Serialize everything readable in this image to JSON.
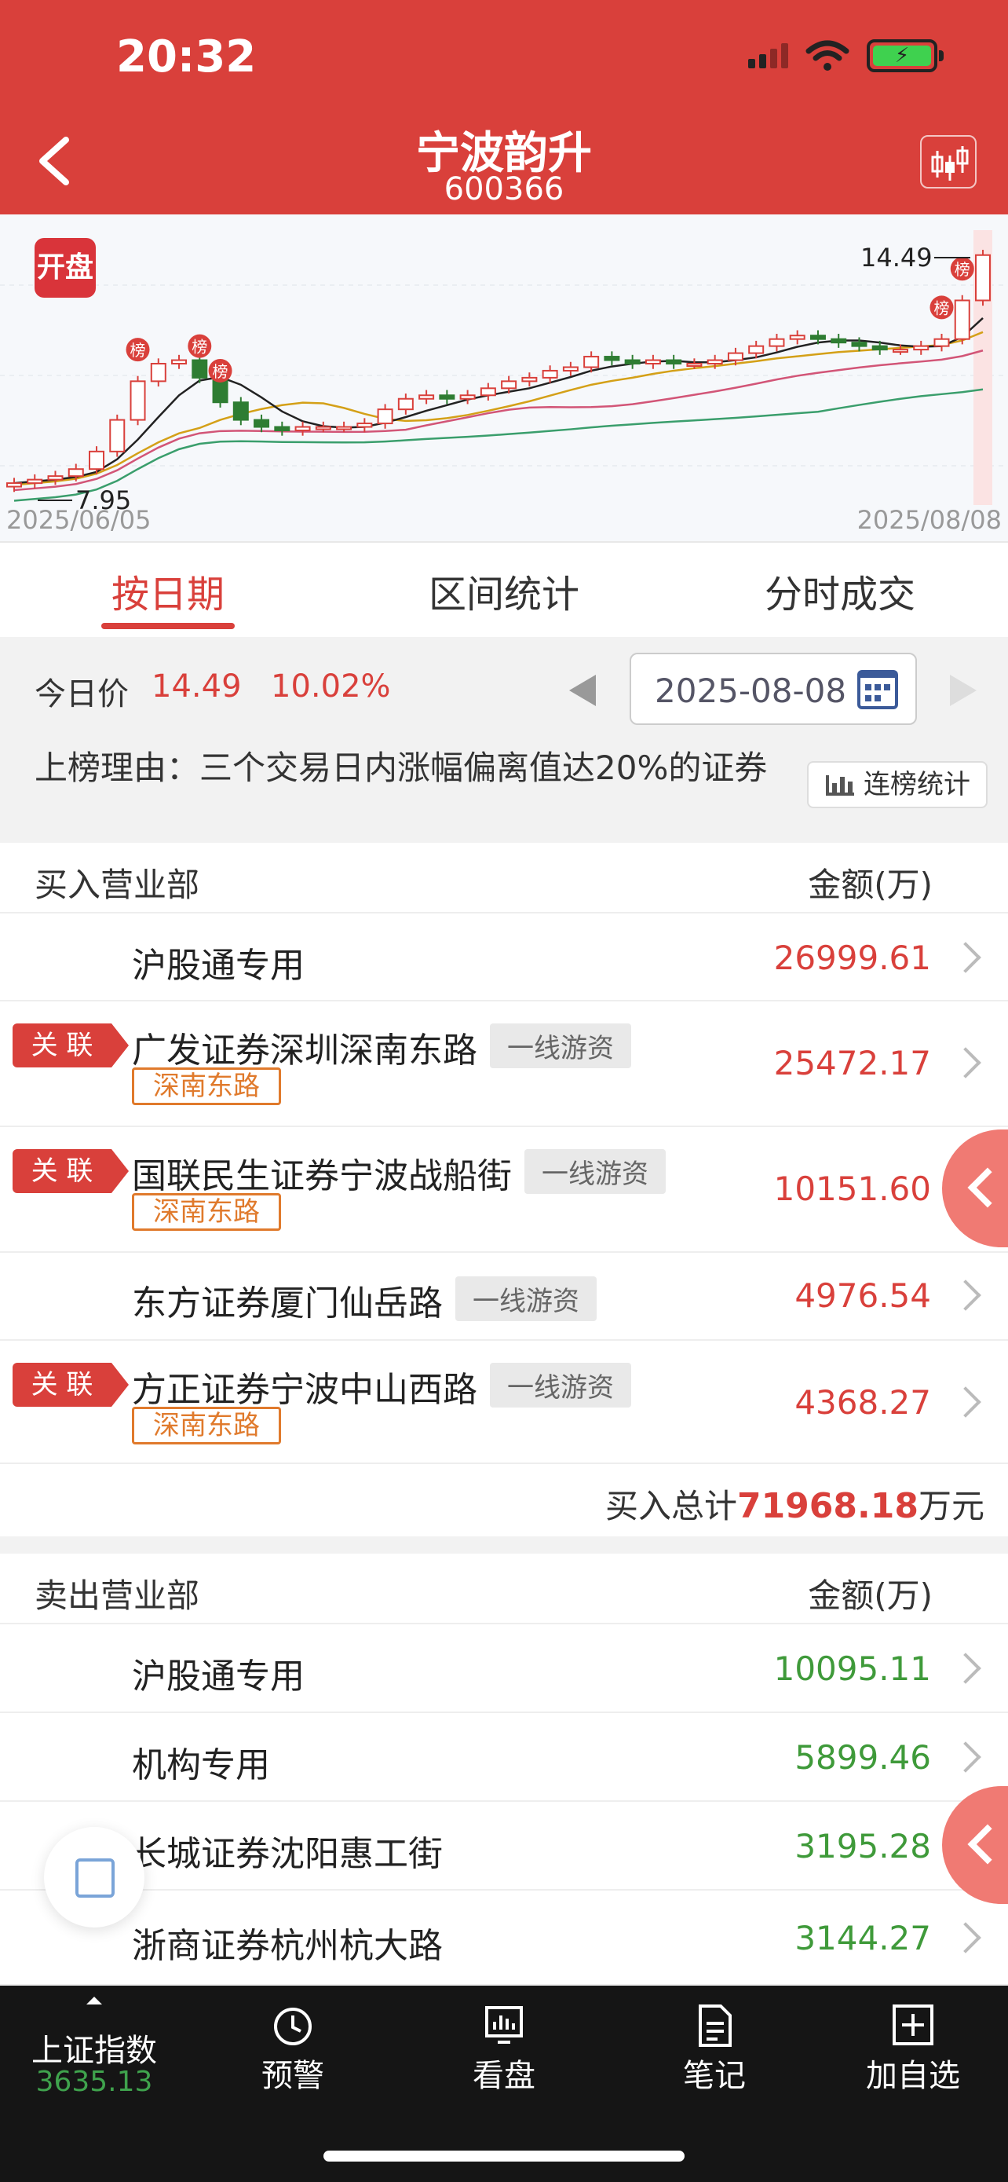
{
  "status_bar": {
    "time": "20:32"
  },
  "header": {
    "title": "宁波韵升",
    "code": "600366"
  },
  "chart_data": {
    "type": "candlestick",
    "badge": "开盘",
    "start_date": "2025/06/05",
    "end_date": "2025/08/08",
    "low_label": "7.95",
    "high_label": "14.49",
    "marker_label": "榜",
    "colors": {
      "up": "#d9403b",
      "down": "#2e7d32",
      "ma5": "#222222",
      "ma10": "#d4a017",
      "ma20": "#d25577",
      "ma60": "#3a9e6c"
    }
  },
  "tabs": [
    {
      "label": "按日期",
      "active": true
    },
    {
      "label": "区间统计",
      "active": false
    },
    {
      "label": "分时成交",
      "active": false
    }
  ],
  "today": {
    "label": "今日价",
    "price": "14.49",
    "change_pct": "10.02%",
    "date": "2025-08-08"
  },
  "reason": {
    "text": "上榜理由：三个交易日内涨幅偏离值达20%的证券",
    "stat_button": "连榜统计"
  },
  "buy": {
    "header_left": "买入营业部",
    "header_right": "金额(万)",
    "rows": [
      {
        "name": "沪股通专用",
        "amount": "26999.61"
      },
      {
        "name": "广发证券深圳深南东路",
        "tag": "一线游资",
        "sub": "深南东路",
        "related": "关 联",
        "amount": "25472.17"
      },
      {
        "name": "国联民生证券宁波战船街",
        "tag": "一线游资",
        "sub": "深南东路",
        "related": "关 联",
        "amount": "10151.60"
      },
      {
        "name": "东方证券厦门仙岳路",
        "tag": "一线游资",
        "amount": "4976.54"
      },
      {
        "name": "方正证券宁波中山西路",
        "tag": "一线游资",
        "sub": "深南东路",
        "related": "关 联",
        "amount": "4368.27"
      }
    ],
    "total_label": "买入总计",
    "total_value": "71968.18",
    "total_unit": "万元"
  },
  "sell": {
    "header_left": "卖出营业部",
    "header_right": "金额(万)",
    "rows": [
      {
        "name": "沪股通专用",
        "amount": "10095.11"
      },
      {
        "name": "机构专用",
        "amount": "5899.46"
      },
      {
        "name": "长城证券沈阳惠工街",
        "amount": "3195.28"
      },
      {
        "name": "浙商证券杭州杭大路",
        "amount": "3144.27"
      }
    ]
  },
  "tabbar": {
    "items": [
      {
        "label": "上证指数",
        "value": "3635.13",
        "icon": "triangle-up-icon"
      },
      {
        "label": "预警",
        "icon": "alarm-clock-icon"
      },
      {
        "label": "看盘",
        "icon": "monitor-icon"
      },
      {
        "label": "笔记",
        "icon": "note-icon"
      },
      {
        "label": "加自选",
        "icon": "plus-box-icon"
      }
    ]
  }
}
